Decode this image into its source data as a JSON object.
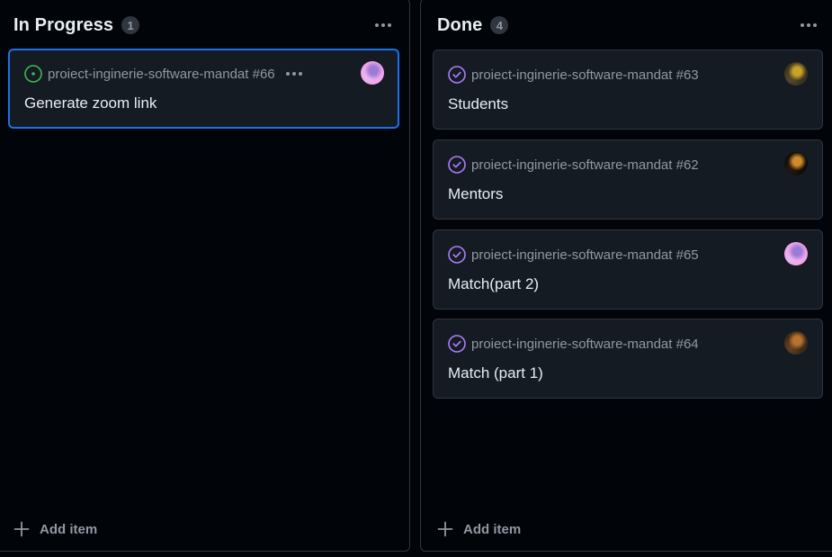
{
  "columns": [
    {
      "title": "In Progress",
      "count": "1",
      "add_label": "Add item",
      "cards": [
        {
          "repo": "proiect-inginerie-software-mandat #66",
          "title": "Generate zoom link",
          "state": "open",
          "state_icon": "issue-opened-icon",
          "selected": true,
          "avatar_colors": [
            "#f0a6e8",
            "#9b7bd6",
            "#e9b6f0"
          ]
        }
      ]
    },
    {
      "title": "Done",
      "count": "4",
      "add_label": "Add item",
      "cards": [
        {
          "repo": "proiect-inginerie-software-mandat #63",
          "title": "Students",
          "state": "closed",
          "state_icon": "issue-closed-icon",
          "avatar_colors": [
            "#3a3320",
            "#c9a227",
            "#5a4a2a"
          ]
        },
        {
          "repo": "proiect-inginerie-software-mandat #62",
          "title": "Mentors",
          "state": "closed",
          "state_icon": "issue-closed-icon",
          "avatar_colors": [
            "#120d08",
            "#d08a2a",
            "#2a1a0e"
          ]
        },
        {
          "repo": "proiect-inginerie-software-mandat #65",
          "title": "Match(part 2)",
          "state": "closed",
          "state_icon": "issue-closed-icon",
          "avatar_colors": [
            "#f0a6e8",
            "#9b7bd6",
            "#e9b6f0"
          ]
        },
        {
          "repo": "proiect-inginerie-software-mandat #64",
          "title": "Match (part 1)",
          "state": "closed",
          "state_icon": "issue-closed-icon",
          "avatar_colors": [
            "#3b2a1a",
            "#b8742e",
            "#6b4422"
          ]
        }
      ]
    }
  ],
  "colors": {
    "background": "#010409",
    "card": "#151b23",
    "border": "#30363d",
    "selected_border": "#1f6feb",
    "open": "#3fb950",
    "closed": "#ab7df8",
    "muted": "#9198a1",
    "text": "#e6edf3"
  }
}
